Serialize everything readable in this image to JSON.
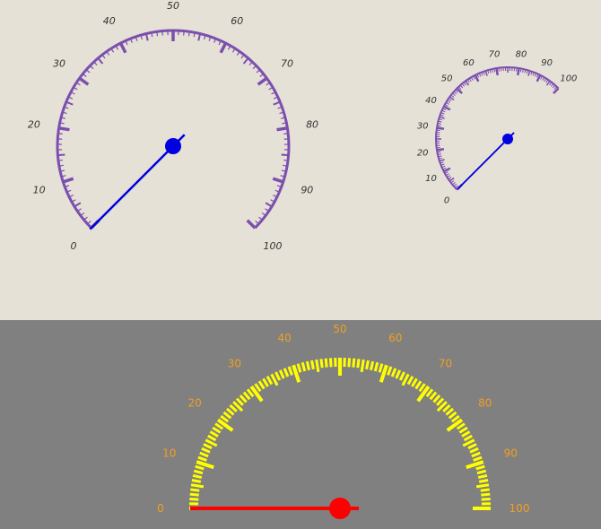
{
  "gauges": [
    {
      "name": "large-gauge",
      "min": 0,
      "max": 100,
      "value": 0,
      "labels": [
        "0",
        "10",
        "20",
        "30",
        "40",
        "50",
        "60",
        "70",
        "80",
        "90",
        "100"
      ],
      "scale_color": "#7b4fae",
      "label_color": "#333333",
      "needle_color": "#0000e0"
    },
    {
      "name": "small-gauge",
      "min": 0,
      "max": 100,
      "value": 0,
      "labels": [
        "0",
        "10",
        "20",
        "30",
        "40",
        "50",
        "60",
        "70",
        "80",
        "90",
        "100"
      ],
      "scale_color": "#7b4fae",
      "label_color": "#333333",
      "needle_color": "#0000e0"
    },
    {
      "name": "bottom-gauge",
      "min": 0,
      "max": 100,
      "value": 0,
      "labels": [
        "0",
        "10",
        "20",
        "30",
        "40",
        "50",
        "60",
        "70",
        "80",
        "90",
        "100"
      ],
      "scale_color": "#ffff00",
      "label_color": "#f0a020",
      "needle_color": "#ff0000"
    }
  ],
  "colors": {
    "top_background": "#e5e1d7",
    "bottom_background": "#808080"
  }
}
